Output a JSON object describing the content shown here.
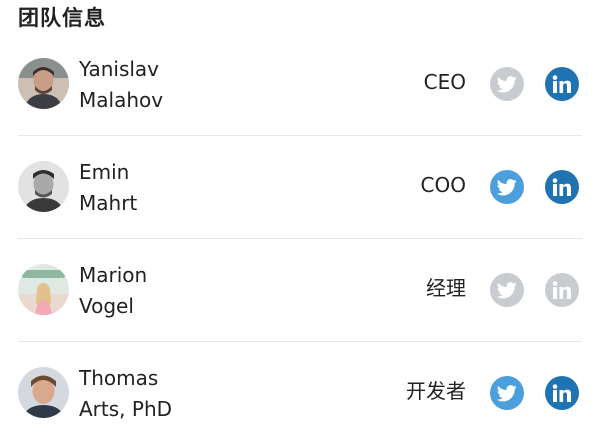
{
  "section": {
    "title": "团队信息"
  },
  "colors": {
    "twitter_active": "#4a9fdc",
    "linkedin_active": "#1f73b2",
    "inactive": "#c8cbcf",
    "divider": "#e8e8e8"
  },
  "members": [
    {
      "first_name": "Yanislav",
      "last_name": "Malahov",
      "role": "CEO",
      "avatar_icon": "avatar-photo",
      "twitter_active": false,
      "linkedin_active": true
    },
    {
      "first_name": "Emin",
      "last_name": "Mahrt",
      "role": "COO",
      "avatar_icon": "avatar-photo",
      "twitter_active": true,
      "linkedin_active": true
    },
    {
      "first_name": "Marion",
      "last_name": "Vogel",
      "role": "经理",
      "avatar_icon": "avatar-photo",
      "twitter_active": false,
      "linkedin_active": false
    },
    {
      "first_name": "Thomas",
      "last_name": "Arts, PhD",
      "role": "开发者",
      "avatar_icon": "avatar-photo",
      "twitter_active": true,
      "linkedin_active": true
    }
  ]
}
